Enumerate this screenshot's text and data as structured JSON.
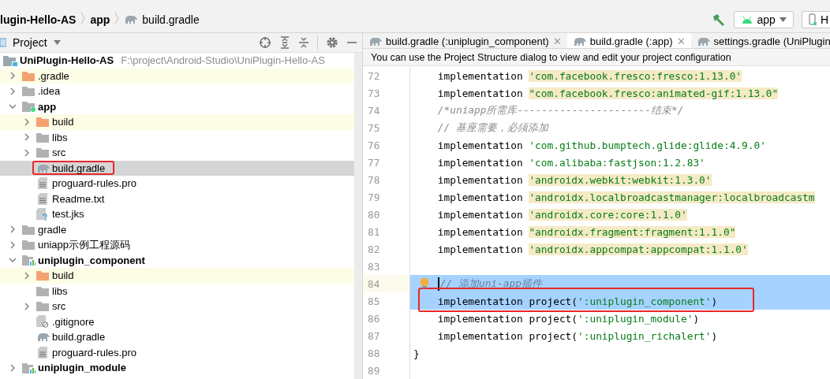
{
  "breadcrumb": [
    {
      "kind": "project",
      "text": "lugin-Hello-AS"
    },
    {
      "kind": "module",
      "text": "app"
    },
    {
      "kind": "gradle",
      "text": "build.gradle"
    }
  ],
  "toolbar": {
    "run_config": "app",
    "device": "H"
  },
  "project_panel": {
    "title": "Project",
    "tree": {
      "text": "UniPlugin-Hello-AS",
      "path": "F:\\project\\Android-Studio\\UniPlugin-Hello-AS",
      "kind": "project",
      "children": [
        {
          "text": ".gradle",
          "kind": "excluded",
          "expanded": false,
          "selected": false
        },
        {
          "text": ".idea",
          "kind": "folder",
          "expanded": false,
          "selected": false
        },
        {
          "text": "app",
          "kind": "app-module",
          "expanded": true,
          "selected": false,
          "children": [
            {
              "text": "build",
              "kind": "excluded",
              "expanded": false,
              "selected": false
            },
            {
              "text": "libs",
              "kind": "folder",
              "expanded": false,
              "selected": false
            },
            {
              "text": "src",
              "kind": "folder",
              "expanded": false,
              "selected": false
            },
            {
              "text": "build.gradle",
              "kind": "gradle",
              "selected": true,
              "annotated": true
            },
            {
              "text": "proguard-rules.pro",
              "kind": "text",
              "selected": false
            },
            {
              "text": "Readme.txt",
              "kind": "text",
              "selected": false
            },
            {
              "text": "test.jks",
              "kind": "unknown",
              "selected": false
            }
          ]
        },
        {
          "text": "gradle",
          "kind": "folder",
          "expanded": false,
          "selected": false
        },
        {
          "text": "uniapp示例工程源码",
          "kind": "folder",
          "expanded": false,
          "selected": false
        },
        {
          "text": "uniplugin_component",
          "kind": "module",
          "expanded": true,
          "selected": false,
          "children": [
            {
              "text": "build",
              "kind": "excluded",
              "expanded": false,
              "selected": false
            },
            {
              "text": "libs",
              "kind": "folder",
              "selected": false
            },
            {
              "text": "src",
              "kind": "folder",
              "expanded": false,
              "selected": false
            },
            {
              "text": ".gitignore",
              "kind": "ignore",
              "selected": false
            },
            {
              "text": "build.gradle",
              "kind": "gradle",
              "selected": false
            },
            {
              "text": "proguard-rules.pro",
              "kind": "text",
              "selected": false
            }
          ]
        },
        {
          "text": "uniplugin_module",
          "kind": "module",
          "expanded": false,
          "selected": false
        }
      ]
    }
  },
  "editor": {
    "tabs": [
      {
        "label": "build.gradle (:uniplugin_component)",
        "selected": false,
        "close": "✕"
      },
      {
        "label": "build.gradle (:app)",
        "selected": true,
        "close": "✕"
      },
      {
        "label": "settings.gradle (UniPlugin",
        "selected": false
      }
    ],
    "notice": "You can use the Project Structure dialog to view and edit your project configuration",
    "lines": [
      {
        "number": "72",
        "segments": [
          {
            "kind": "plain",
            "text": "    implementation "
          },
          {
            "kind": "string",
            "text": "'com.facebook.fresco:fresco:1.13.0'",
            "highlighted": true
          }
        ]
      },
      {
        "number": "73",
        "segments": [
          {
            "kind": "plain",
            "text": "    implementation "
          },
          {
            "kind": "string",
            "text": "\"com.facebook.fresco:animated-gif:1.13.0\"",
            "highlighted": true
          }
        ]
      },
      {
        "number": "74",
        "segments": [
          {
            "kind": "comment",
            "text": "    /*uniapp所需库----------------------结束*/"
          }
        ]
      },
      {
        "number": "75",
        "segments": [
          {
            "kind": "comment",
            "text": "    // 基座需要，必须添加"
          }
        ]
      },
      {
        "number": "76",
        "segments": [
          {
            "kind": "plain",
            "text": "    implementation "
          },
          {
            "kind": "string",
            "text": "'com.github.bumptech.glide:glide:4.9.0'",
            "highlighted": false
          }
        ]
      },
      {
        "number": "77",
        "segments": [
          {
            "kind": "plain",
            "text": "    implementation "
          },
          {
            "kind": "string",
            "text": "'com.alibaba:fastjson:1.2.83'",
            "highlighted": false
          }
        ]
      },
      {
        "number": "78",
        "segments": [
          {
            "kind": "plain",
            "text": "    implementation "
          },
          {
            "kind": "string",
            "text": "'androidx.webkit:webkit:1.3.0'",
            "highlighted": true
          }
        ]
      },
      {
        "number": "79",
        "segments": [
          {
            "kind": "plain",
            "text": "    implementation "
          },
          {
            "kind": "string",
            "text": "'androidx.localbroadcastmanager:localbroadcastm",
            "highlighted": true
          }
        ]
      },
      {
        "number": "80",
        "segments": [
          {
            "kind": "plain",
            "text": "    implementation "
          },
          {
            "kind": "string",
            "text": "'androidx.core:core:1.1.0'",
            "highlighted": true
          }
        ]
      },
      {
        "number": "81",
        "segments": [
          {
            "kind": "plain",
            "text": "    implementation "
          },
          {
            "kind": "string",
            "text": "\"androidx.fragment:fragment:1.1.0\"",
            "highlighted": true
          }
        ]
      },
      {
        "number": "82",
        "segments": [
          {
            "kind": "plain",
            "text": "    implementation "
          },
          {
            "kind": "string",
            "text": "'androidx.appcompat:appcompat:1.1.0'",
            "highlighted": true
          }
        ]
      },
      {
        "number": "83"
      },
      {
        "number": "84",
        "current": true,
        "selected": true,
        "segments": [
          {
            "kind": "faint",
            "text": "// 添加uni-app插件"
          }
        ]
      },
      {
        "number": "85",
        "selected": true,
        "annotated": true,
        "segments": [
          {
            "kind": "plain",
            "text": "    implementation project("
          },
          {
            "kind": "string",
            "text": "':uniplugin_component'",
            "highlighted": false
          },
          {
            "kind": "plain",
            "text": ")"
          }
        ]
      },
      {
        "number": "86",
        "segments": [
          {
            "kind": "plain",
            "text": "    implementation project("
          },
          {
            "kind": "string",
            "text": "':uniplugin_module'",
            "highlighted": false
          },
          {
            "kind": "plain",
            "text": ")"
          }
        ]
      },
      {
        "number": "87",
        "segments": [
          {
            "kind": "plain",
            "text": "    implementation project("
          },
          {
            "kind": "string",
            "text": "':uniplugin_richalert'",
            "highlighted": false
          },
          {
            "kind": "plain",
            "text": ")"
          }
        ]
      },
      {
        "number": "88",
        "segments": [
          {
            "kind": "plain",
            "text": "}"
          }
        ]
      },
      {
        "number": "89"
      }
    ]
  }
}
